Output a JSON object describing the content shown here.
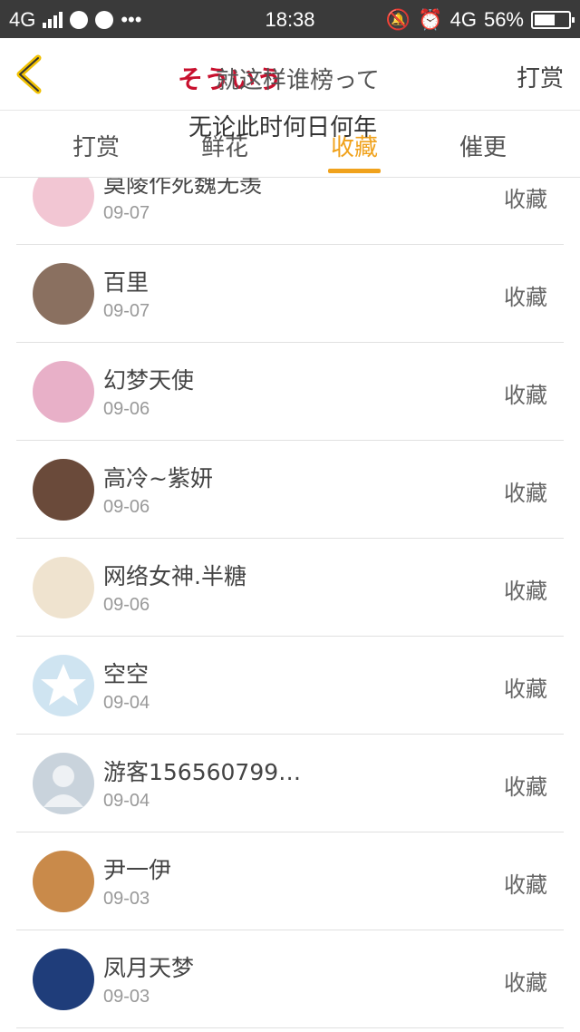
{
  "status_bar": {
    "network_left": "4G",
    "time": "18:38",
    "network_right": "4G",
    "battery": "56%"
  },
  "nav": {
    "title_red": "そういう",
    "title_overlay": "就这样谁榜って",
    "action": "打赏"
  },
  "overlay_caption": "无论此时何日何年",
  "tabs": [
    {
      "label": "打赏"
    },
    {
      "label": "鲜花"
    },
    {
      "label": "收藏"
    },
    {
      "label": "催更"
    }
  ],
  "active_tab": "收藏",
  "rows": [
    {
      "name": "莫陵作死魏无羡",
      "date": "09-07",
      "action": "收藏",
      "avatar_color": "#f2c6d3"
    },
    {
      "name": "百里",
      "date": "09-07",
      "action": "收藏",
      "avatar_color": "#8a7060"
    },
    {
      "name": "幻梦天使",
      "date": "09-06",
      "action": "收藏",
      "avatar_color": "#e8b0c8"
    },
    {
      "name": "高冷~紫妍",
      "date": "09-06",
      "action": "收藏",
      "avatar_color": "#6a4a3a"
    },
    {
      "name": "网络女神.半糖",
      "date": "09-06",
      "action": "收藏",
      "avatar_color": "#efe3cf"
    },
    {
      "name": "空空",
      "date": "09-04",
      "action": "收藏",
      "avatar_color": "#cfe4f1"
    },
    {
      "name": "游客156560799…",
      "date": "09-04",
      "action": "收藏",
      "avatar_color": "#c9d3dc"
    },
    {
      "name": "尹一伊",
      "date": "09-03",
      "action": "收藏",
      "avatar_color": "#c98a4a"
    },
    {
      "name": "凤月天梦",
      "date": "09-03",
      "action": "收藏",
      "avatar_color": "#1f3d7a"
    }
  ]
}
